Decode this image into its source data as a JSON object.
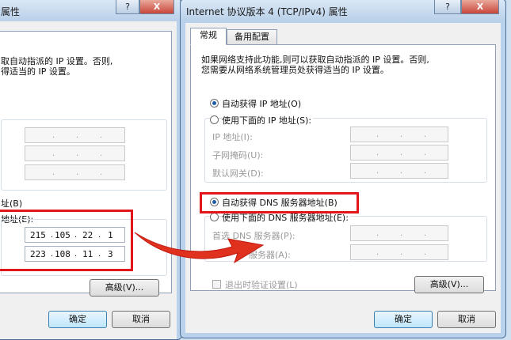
{
  "left_dialog": {
    "title": "属性",
    "help": "?",
    "close": "X",
    "desc_line1": "取自动指派的 IP 设置。否则,",
    "desc_line2": "得适当的 IP 设置。",
    "dns_auto_fragment": "址(B)",
    "dns_manual_fragment": "地址(E):",
    "dns_preferred": [
      "215",
      "105",
      "22",
      "1"
    ],
    "dns_alternate": [
      "223",
      "108",
      "11",
      "3"
    ],
    "advanced": "高级(V)...",
    "ok": "确定",
    "cancel": "取消"
  },
  "right_dialog": {
    "title": "Internet 协议版本 4 (TCP/IPv4) 属性",
    "help": "?",
    "close": "X",
    "tabs": [
      "常规",
      "备用配置"
    ],
    "desc_line1": "如果网络支持此功能,则可以获取自动指派的 IP 设置。否则,",
    "desc_line2": "您需要从网络系统管理员处获得适当的 IP 设置。",
    "ip_auto": "自动获得 IP 地址(O)",
    "ip_manual": "使用下面的 IP 地址(S):",
    "ip_label": "IP 地址(I):",
    "mask_label": "子网掩码(U):",
    "gateway_label": "默认网关(D):",
    "dns_auto": "自动获得 DNS 服务器地址(B)",
    "dns_manual": "使用下面的 DNS 服务器地址(E):",
    "dns_pref_label": "首选 DNS 服务器(P):",
    "dns_alt_label": "服务器(A):",
    "validate": "退出时验证设置(L)",
    "advanced": "高级(V)...",
    "ok": "确定",
    "cancel": "取消"
  },
  "colors": {
    "highlight": "#e0161a",
    "arrow": "#e0301e"
  }
}
